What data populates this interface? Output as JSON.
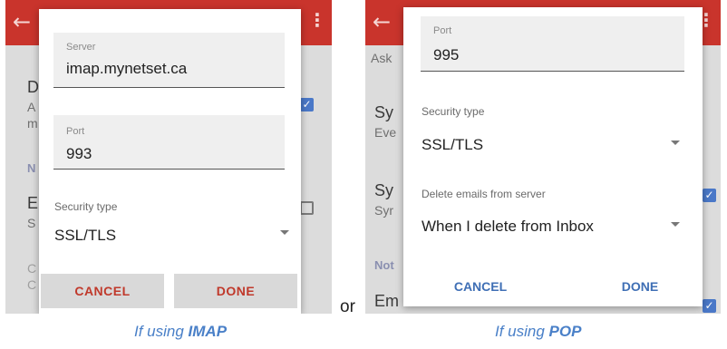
{
  "imap": {
    "bg": {
      "texts": [
        "D",
        "A",
        "m",
        "N",
        "E",
        "S",
        "C",
        "C"
      ]
    },
    "server": {
      "label": "Server",
      "value": "imap.mynetset.ca"
    },
    "port": {
      "label": "Port",
      "value": "993"
    },
    "security": {
      "label": "Security type",
      "value": "SSL/TLS"
    },
    "buttons": {
      "cancel": "CANCEL",
      "done": "DONE"
    }
  },
  "or_text": "or",
  "pop": {
    "bg": {
      "texts": [
        "Ask",
        "Sy",
        "Eve",
        "Sy",
        "Syr",
        "Not",
        "Em"
      ]
    },
    "port": {
      "label": "Port",
      "value": "995"
    },
    "security": {
      "label": "Security type",
      "value": "SSL/TLS"
    },
    "delete": {
      "label": "Delete emails from server",
      "value": "When I delete from Inbox"
    },
    "buttons": {
      "cancel": "CANCEL",
      "done": "DONE"
    }
  },
  "captions": {
    "imap": {
      "prefix": "If using ",
      "bold": "IMAP"
    },
    "pop": {
      "prefix": "If using ",
      "bold": "POP"
    }
  },
  "colors": {
    "appbar": "#c9342c",
    "accent": "#3f6fb5",
    "caption": "#4a80c8",
    "cancel_red": "#c0392b"
  }
}
